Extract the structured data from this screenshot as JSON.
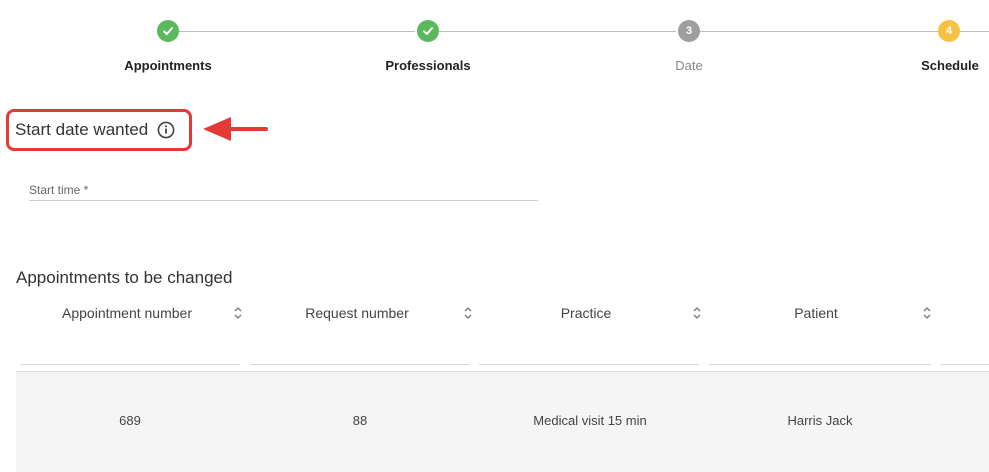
{
  "stepper": {
    "steps": [
      {
        "label": "Appointments",
        "state": "done",
        "number": ""
      },
      {
        "label": "Professionals",
        "state": "done",
        "number": ""
      },
      {
        "label": "Date",
        "state": "current",
        "number": "3"
      },
      {
        "label": "Schedule",
        "state": "pending",
        "number": "4"
      }
    ]
  },
  "section": {
    "title": "Start date wanted",
    "icon": "info-icon"
  },
  "form": {
    "start_time_label": "Start time *",
    "start_time_value": ""
  },
  "table": {
    "title": "Appointments to be changed",
    "columns": [
      "Appointment number",
      "Request number",
      "Practice",
      "Patient"
    ],
    "rows": [
      [
        "689",
        "88",
        "Medical visit 15 min",
        "Harris Jack"
      ]
    ]
  },
  "colors": {
    "done": "#5cb85c",
    "current": "#9e9e9e",
    "pending": "#f6c244",
    "annotation": "#e53935"
  }
}
